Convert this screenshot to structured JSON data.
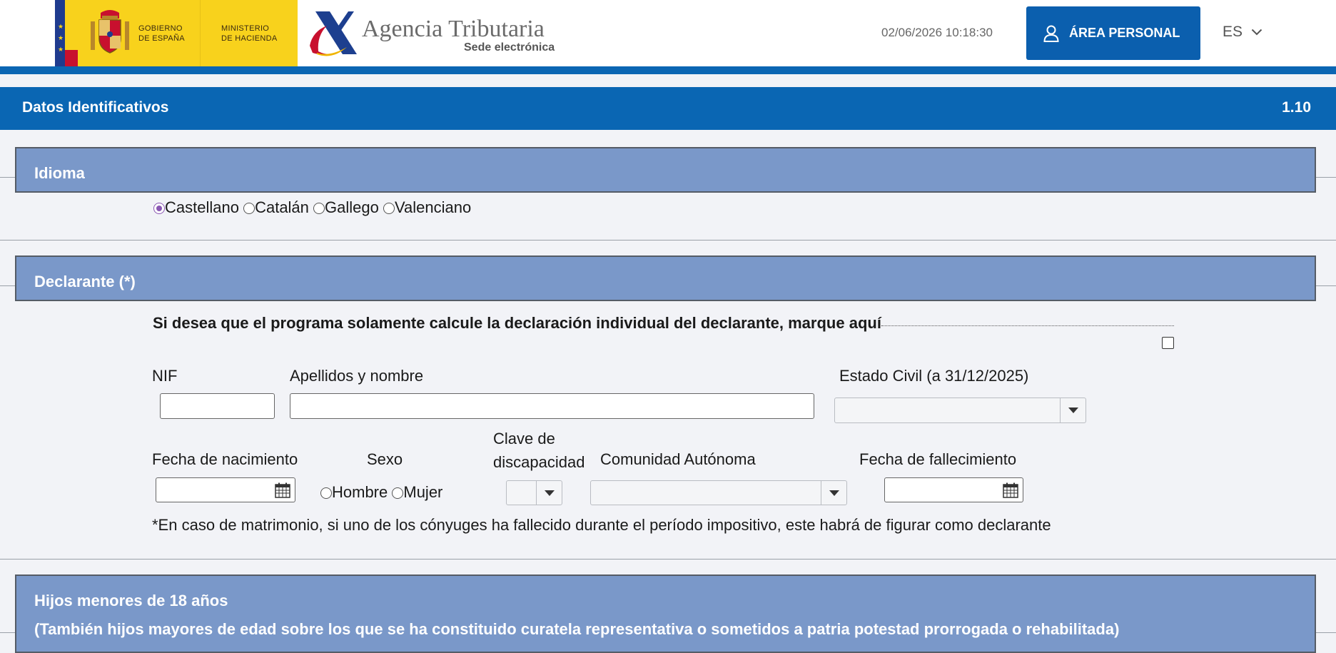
{
  "header": {
    "gov_line1": "GOBIERNO",
    "gov_line2": "DE ESPAÑA",
    "ministry_line1": "MINISTERIO",
    "ministry_line2": "DE HACIENDA",
    "agency_title": "Agencia Tributaria",
    "agency_subtitle": "Sede electrónica",
    "datetime": "02/06/2026 10:18:30",
    "personal_button": "ÁREA PERSONAL",
    "language": "ES"
  },
  "titlebar": {
    "title": "Datos Identificativos",
    "version": "1.10"
  },
  "idioma": {
    "header": "Idioma",
    "options": [
      "Castellano",
      "Catalán",
      "Gallego",
      "Valenciano"
    ],
    "selected": "Castellano"
  },
  "declarante": {
    "header": "Declarante (*)",
    "individual_prompt": "Si desea que el programa solamente calcule la declaración individual del declarante, marque aquí",
    "individual_checked": false,
    "nif_label": "NIF",
    "nif_value": "",
    "name_label": "Apellidos y nombre",
    "name_value": "",
    "civil_label": "Estado Civil (a 31/12/2025)",
    "civil_value": "",
    "birth_label": "Fecha de nacimiento",
    "birth_value": "",
    "sex_label": "Sexo",
    "sex_options": [
      "Hombre",
      "Mujer"
    ],
    "disability_label_1": "Clave de",
    "disability_label_2": "discapacidad",
    "disability_value": "",
    "community_label": "Comunidad Autónoma",
    "community_value": "",
    "death_label": "Fecha de fallecimiento",
    "death_value": "",
    "note": "*En caso de matrimonio, si uno de los cónyuges ha fallecido durante el período impositivo, este habrá de figurar como declarante"
  },
  "hijos": {
    "header_line1": "Hijos menores de 18 años",
    "header_line2": "(También hijos mayores de edad sobre los que se ha constituido curatela representativa o sometidos a patria potestad prorrogada o rehabilitada)"
  }
}
